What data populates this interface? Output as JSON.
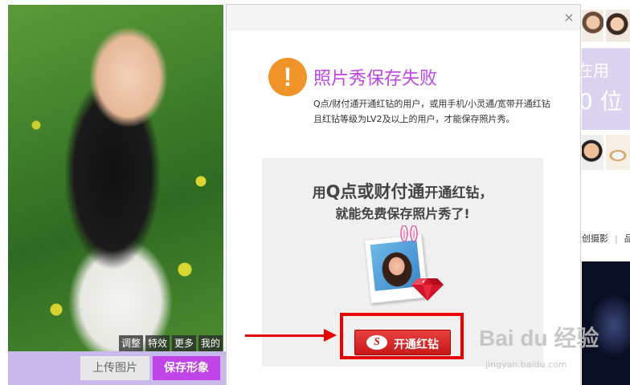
{
  "editor": {
    "tools": [
      "调整",
      "特效",
      "更多",
      "我的"
    ],
    "upload_label": "上传图片",
    "save_label": "保存形象"
  },
  "dialog": {
    "close_glyph": "×",
    "warning_glyph": "!",
    "title": "照片秀保存失败",
    "description": "Q点/财付通开通红钻的用户，或用手机/小灵通/宽带开通红钻且红钻等级为LV2及以上的用户，才能保存照片秀。",
    "promo": {
      "line1_prefix": "用",
      "line1_big": "Q点或财付通",
      "line1_suffix": "开通红钻，",
      "line2": "就能免费保存照片秀了!"
    },
    "open_button_label": "开通红钻",
    "open_button_logo": "S"
  },
  "background_page": {
    "band_text_1": "在用",
    "band_text_2": "0 位",
    "tab_text_1": "创摄影",
    "tab_text_2": "品"
  },
  "watermark": {
    "main": "Bai du 经验",
    "sub": "jingyan.baidu.com"
  },
  "colors": {
    "accent_purple": "#c144e8",
    "warning_orange": "#f09328",
    "button_red": "#d21c1c",
    "annotation_red": "#e80000"
  }
}
